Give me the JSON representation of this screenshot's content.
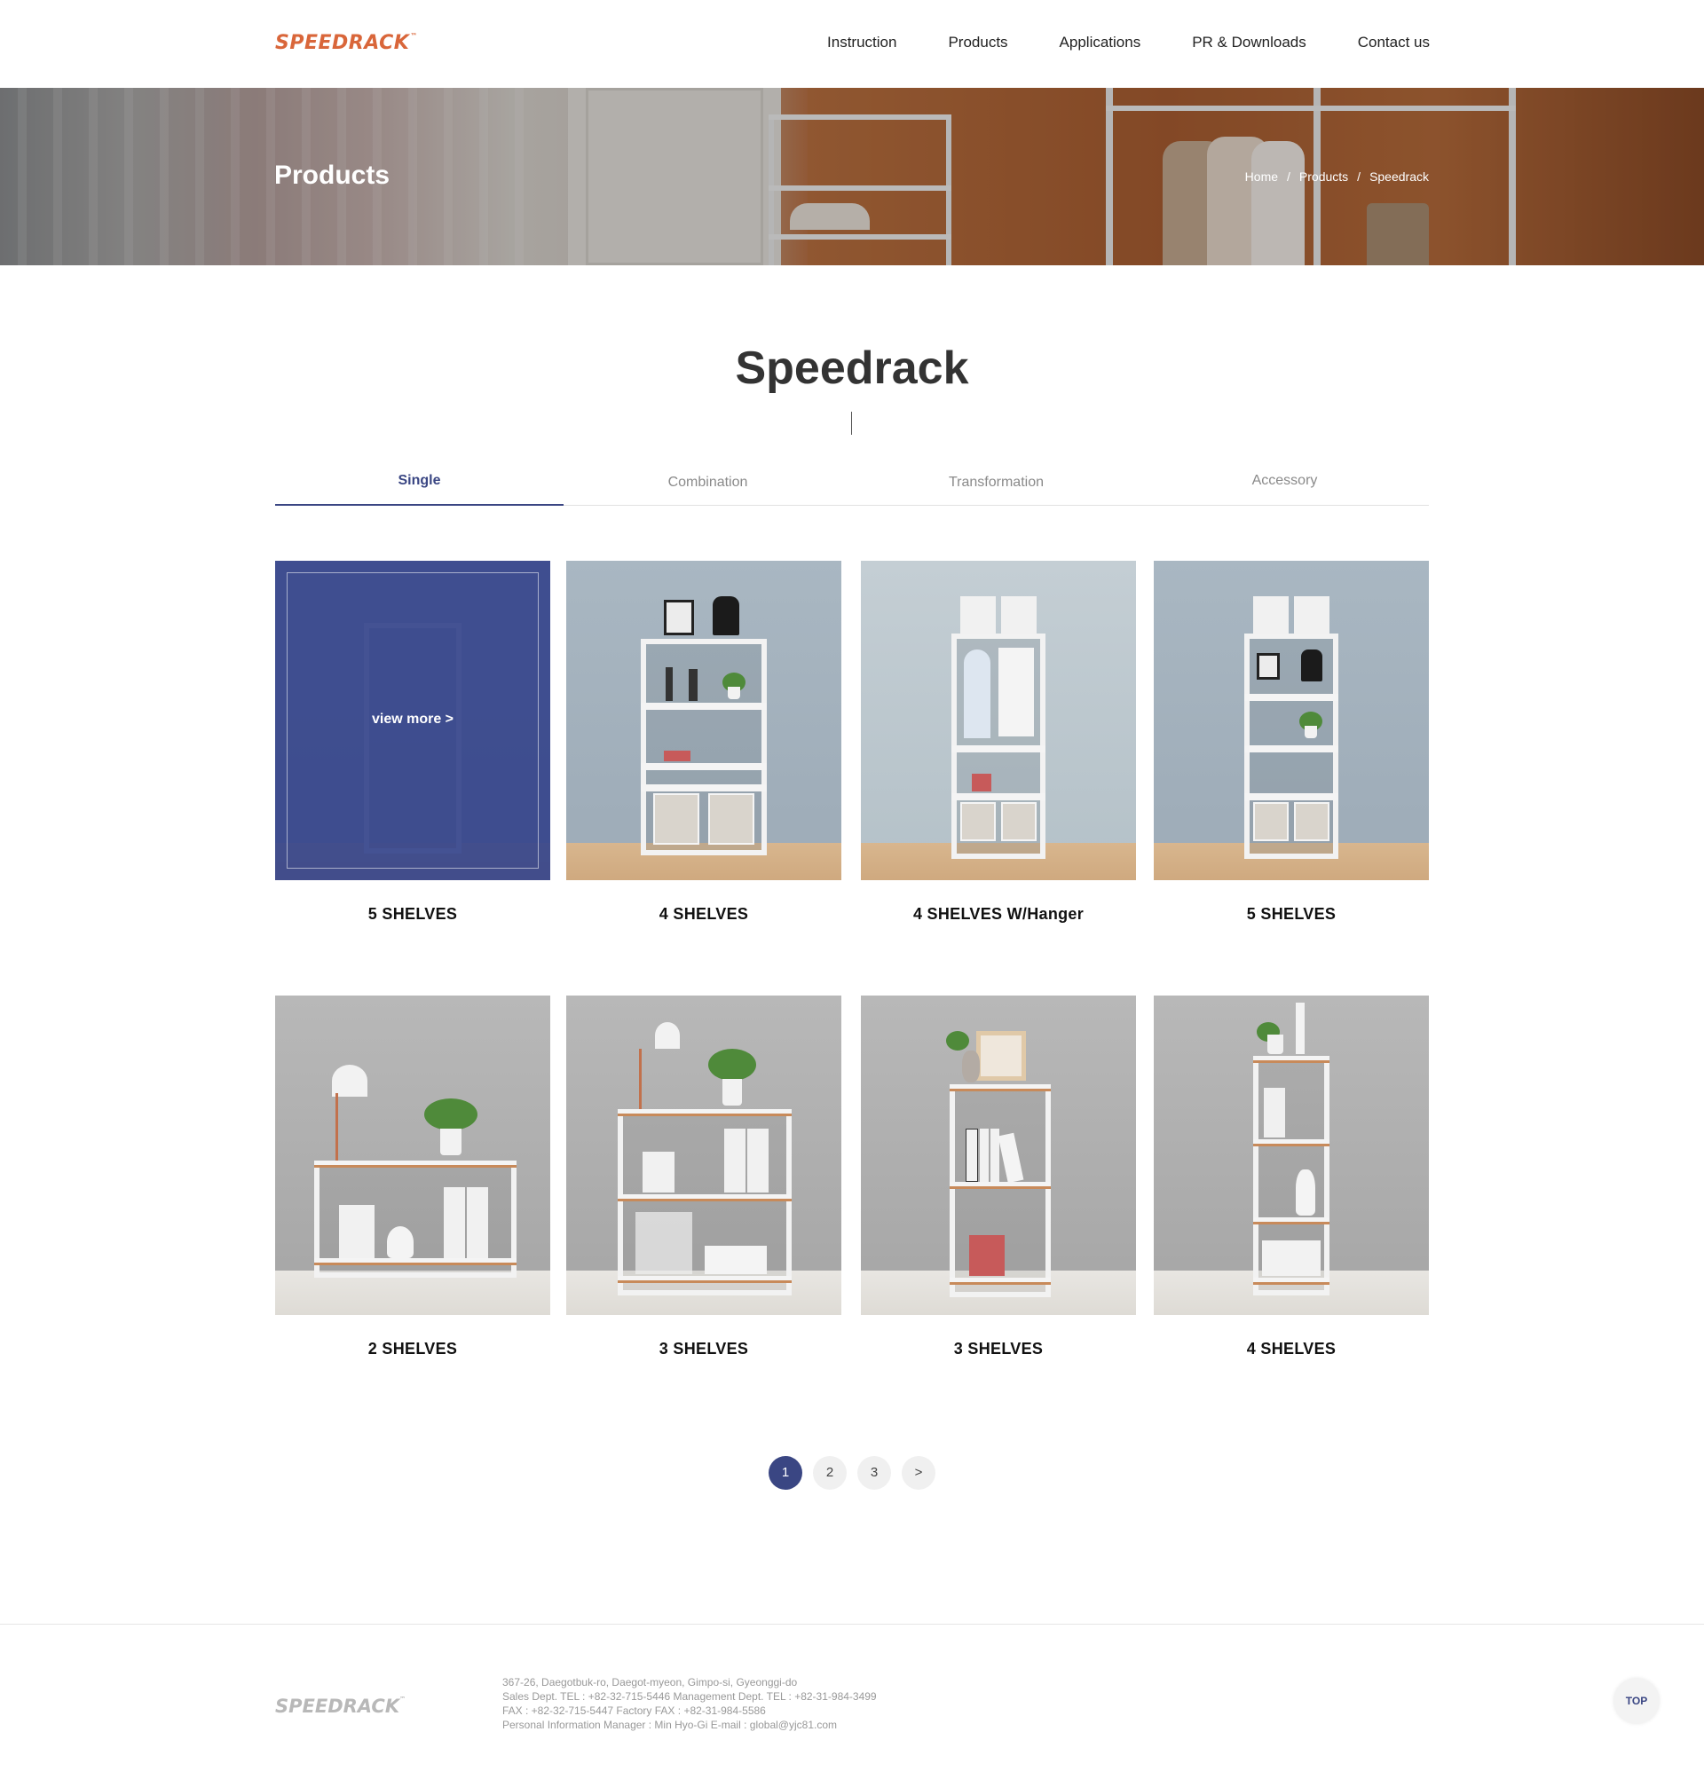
{
  "header": {
    "logo": "SPEEDRACK",
    "logo_tm": "™",
    "nav": [
      "Instruction",
      "Products",
      "Applications",
      "PR & Downloads",
      "Contact us"
    ]
  },
  "banner": {
    "title": "Products",
    "breadcrumb": [
      "Home",
      "/",
      "Products",
      "/",
      "Speedrack"
    ]
  },
  "main": {
    "title": "Speedrack",
    "tabs": [
      {
        "label": "Single",
        "active": true
      },
      {
        "label": "Combination",
        "active": false
      },
      {
        "label": "Transformation",
        "active": false
      },
      {
        "label": "Accessory",
        "active": false
      }
    ],
    "view_more": "view more >",
    "products": [
      {
        "name": "5 SHELVES"
      },
      {
        "name": "4 SHELVES"
      },
      {
        "name": "4 SHELVES W/Hanger"
      },
      {
        "name": "5 SHELVES"
      },
      {
        "name": "2 SHELVES"
      },
      {
        "name": "3 SHELVES"
      },
      {
        "name": "3 SHELVES"
      },
      {
        "name": "4 SHELVES"
      }
    ]
  },
  "pagination": {
    "pages": [
      "1",
      "2",
      "3",
      ">"
    ],
    "current": "1"
  },
  "footer": {
    "logo": "SPEEDRACK",
    "logo_tm": "™",
    "lines": [
      "367-26, Daegotbuk-ro, Daegot-myeon, Gimpo-si, Gyeonggi-do",
      "Sales Dept. TEL : +82-32-715-5446   Management Dept. TEL : +82-31-984-3499",
      "FAX : +82-32-715-5447   Factory FAX : +82-31-984-5586",
      "Personal Information Manager : Min Hyo-Gi   E-mail : global@yjc81.com"
    ],
    "top_button": "TOP"
  },
  "colors": {
    "brand_orange": "#d9663a",
    "accent_navy": "#3a4683"
  }
}
